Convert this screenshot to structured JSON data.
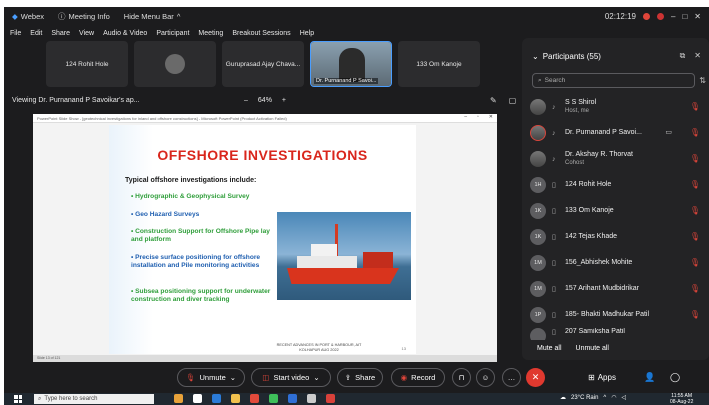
{
  "titlebar": {
    "app": "Webex",
    "meeting_info": "Meeting Info",
    "hide_menu": "Hide Menu Bar",
    "time": "02:12:19",
    "win_min": "–",
    "win_max": "□",
    "win_close": "✕"
  },
  "menu": [
    "File",
    "Edit",
    "Share",
    "View",
    "Audio & Video",
    "Participant",
    "Meeting",
    "Breakout Sessions",
    "Help"
  ],
  "thumbnails": [
    {
      "label": "124 Rohit Hole"
    },
    {
      "label": ""
    },
    {
      "label": "Guruprasad Ajay Chava..."
    },
    {
      "label": "Dr. Purnanand P Savoi..."
    },
    {
      "label": "133 Om Kanoje"
    }
  ],
  "viewing": {
    "label": "Viewing Dr. Purnanand P Savoikar's ap...",
    "zoom_minus": "–",
    "zoom_level": "64%",
    "zoom_plus": "+"
  },
  "ppt": {
    "window_title": "PowerPoint Slide Show - [geotechnical investigations for inland and offshore constructions] - Microsoft PowerPoint (Product Activation Failed)",
    "status": "Slide 13 of 121"
  },
  "slide": {
    "heading": "OFFSHORE INVESTIGATIONS",
    "subheading": "Typical offshore investigations include:",
    "bullets": [
      "Hydrographic & Geophysical Survey",
      "Geo Hazard Surveys",
      "Construction Support for Offshore Pipe lay and platform",
      "Precise surface positioning for offshore installation and Pile monitoring activities",
      "Subsea positioning support for underwater construction and diver tracking"
    ],
    "footer": "RECENT ADVANCES IN PORT & HARBOUR, AIT KOLHAPUR AUG 2022",
    "page": "13"
  },
  "participants": {
    "title": "Participants (55)",
    "search_placeholder": "Search",
    "list": [
      {
        "initials": "",
        "name": "S S Shirol",
        "role": "Host, me"
      },
      {
        "initials": "",
        "name": "Dr. Purnanand P Savoi...",
        "role": ""
      },
      {
        "initials": "",
        "name": "Dr. Akshay R. Thorvat",
        "role": "Cohost"
      },
      {
        "initials": "1H",
        "name": "124 Rohit Hole",
        "role": ""
      },
      {
        "initials": "1K",
        "name": "133 Om Kanoje",
        "role": ""
      },
      {
        "initials": "1K",
        "name": "142 Tejas Khade",
        "role": ""
      },
      {
        "initials": "1M",
        "name": "156_Abhishek Mohite",
        "role": ""
      },
      {
        "initials": "1M",
        "name": "157 Arihant Mudbidrikar",
        "role": ""
      },
      {
        "initials": "1P",
        "name": "185- Bhakti Madhukar Patil",
        "role": ""
      },
      {
        "initials": "",
        "name": "207 Samiksha Patil",
        "role": ""
      }
    ],
    "mute_all": "Mute all",
    "unmute_all": "Unmute all"
  },
  "controls": {
    "unmute": "Unmute",
    "start_video": "Start video",
    "share": "Share",
    "record": "Record",
    "apps": "Apps"
  },
  "taskbar": {
    "search_placeholder": "Type here to search",
    "weather": "23°C  Rain",
    "time": "11:55 AM",
    "date": "08-Aug-22"
  },
  "colors": {
    "accent": "#4a9eff",
    "danger": "#e0453a",
    "slide_heading": "#d9261c",
    "slide_green": "#2f9e3a",
    "slide_blue": "#1f5fb0"
  }
}
